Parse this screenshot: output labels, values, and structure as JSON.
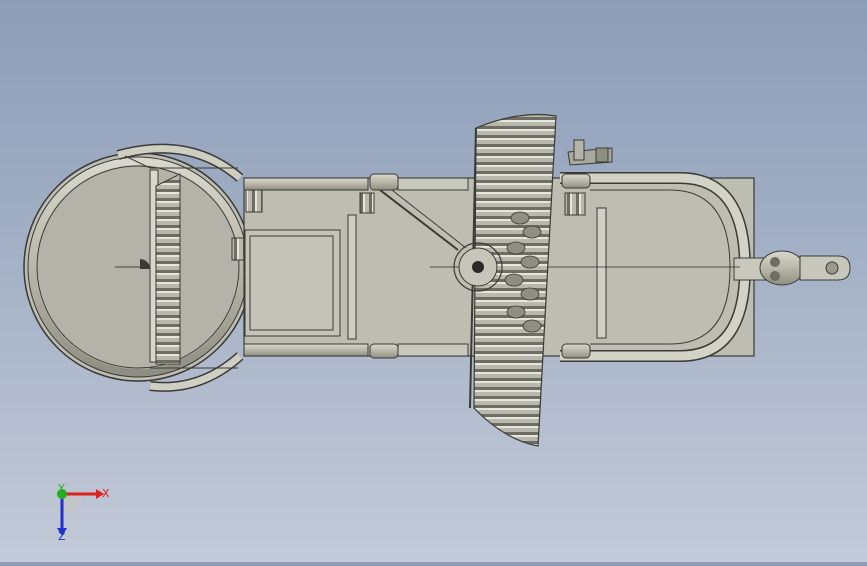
{
  "viewport": {
    "background_top": "#8c9db8",
    "background_bottom": "#c3cad8",
    "model": "cad-assembly-top-view"
  },
  "triad": {
    "x_label": "X",
    "y_label": "Y",
    "z_label": "Z",
    "x_color": "#e02020",
    "y_color": "#20b020",
    "z_color": "#2030d0"
  }
}
